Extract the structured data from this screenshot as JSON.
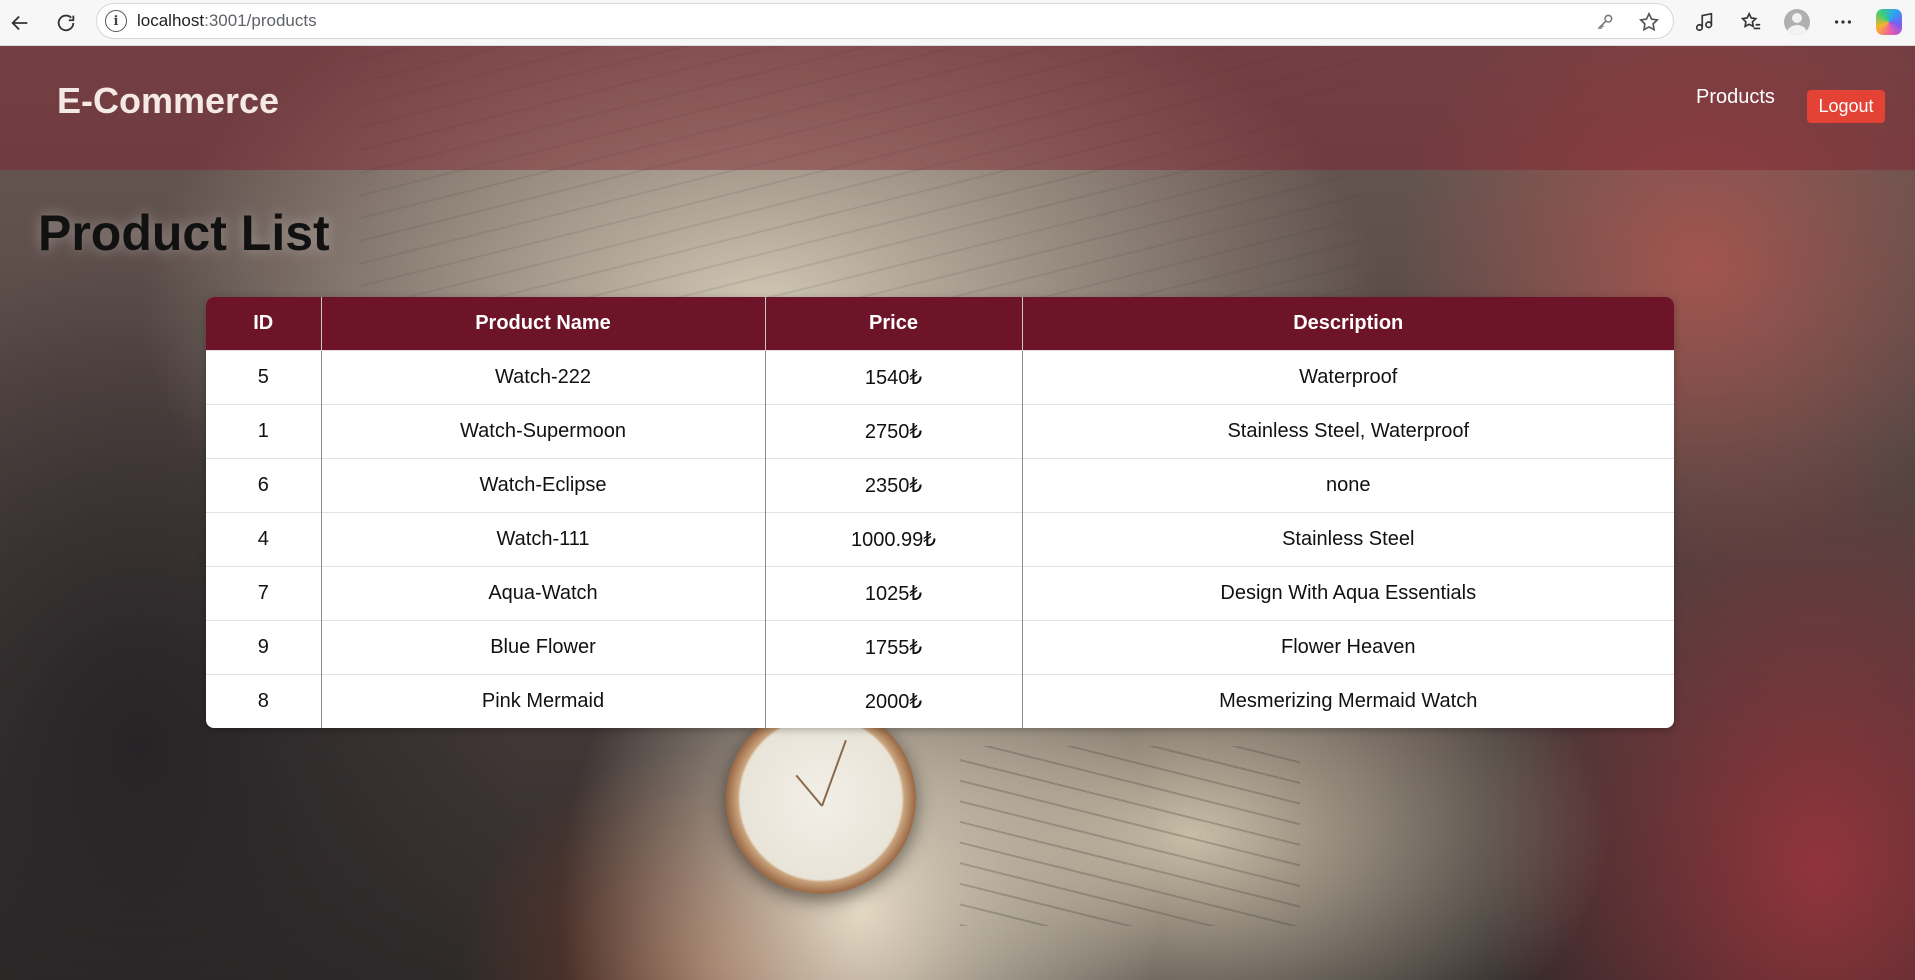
{
  "browser": {
    "url_host": "localhost",
    "url_path": ":3001/products"
  },
  "header": {
    "brand": "E-Commerce",
    "nav_products": "Products",
    "logout_label": "Logout"
  },
  "page": {
    "title": "Product List"
  },
  "table": {
    "columns": [
      "ID",
      "Product Name",
      "Price",
      "Description"
    ],
    "rows": [
      {
        "id": "5",
        "name": "Watch-222",
        "price": "1540₺",
        "description": "Waterproof"
      },
      {
        "id": "1",
        "name": "Watch-Supermoon",
        "price": "2750₺",
        "description": "Stainless Steel, Waterproof"
      },
      {
        "id": "6",
        "name": "Watch-Eclipse",
        "price": "2350₺",
        "description": "none"
      },
      {
        "id": "4",
        "name": "Watch-111",
        "price": "1000.99₺",
        "description": "Stainless Steel"
      },
      {
        "id": "7",
        "name": "Aqua-Watch",
        "price": "1025₺",
        "description": "Design With Aqua Essentials"
      },
      {
        "id": "9",
        "name": "Blue Flower",
        "price": "1755₺",
        "description": "Flower Heaven"
      },
      {
        "id": "8",
        "name": "Pink Mermaid",
        "price": "2000₺",
        "description": "Mesmerizing Mermaid Watch"
      }
    ]
  },
  "colors": {
    "header_overlay": "#801e2c",
    "table_header": "#6e1428",
    "logout_button": "#e34234"
  },
  "icons": {
    "back": "back-arrow-icon",
    "reload": "reload-icon",
    "site_info": "info-icon",
    "password": "key-icon",
    "favorite": "star-icon",
    "extensions": "music-extension-icon",
    "favorites_list": "favorites-icon",
    "profile": "profile-avatar-icon",
    "menu": "more-icon",
    "copilot": "copilot-icon"
  }
}
